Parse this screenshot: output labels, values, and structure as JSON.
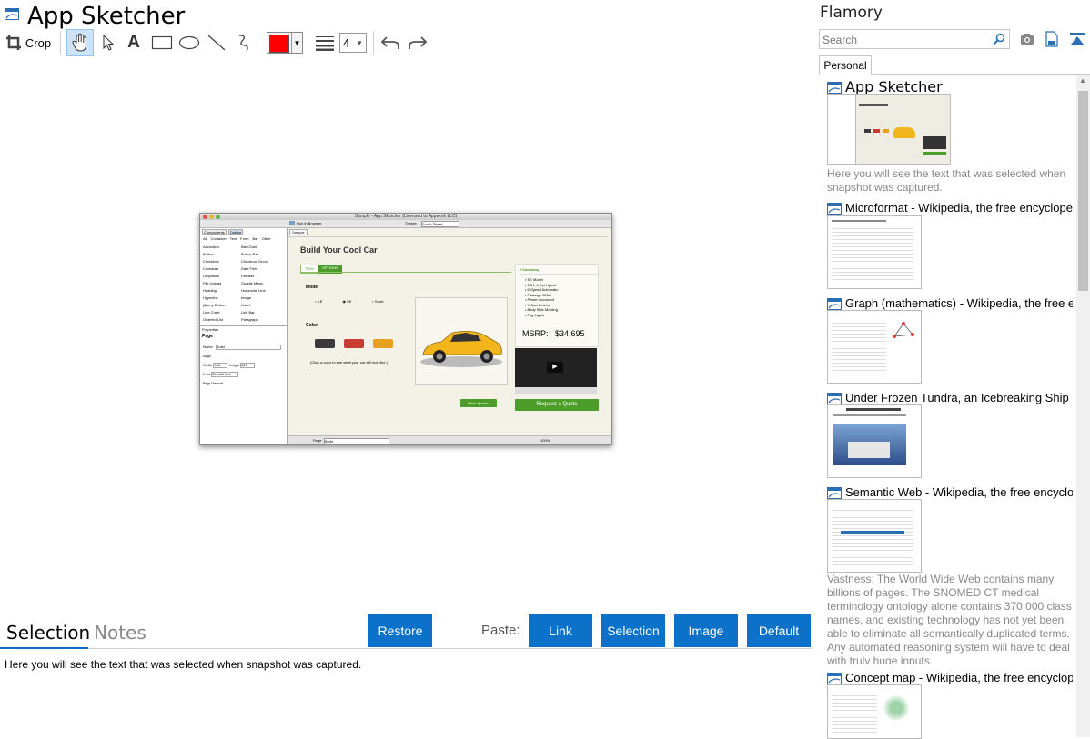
{
  "app": {
    "title": "App Sketcher"
  },
  "toolbar": {
    "crop_label": "Crop",
    "line_width": "4",
    "color": "#ff0000",
    "tools": [
      "hand-tool",
      "select-tool",
      "text-tool",
      "rectangle-tool",
      "ellipse-tool",
      "line-tool",
      "freehand-tool"
    ]
  },
  "bottom": {
    "tabs": [
      "Selection",
      "Notes"
    ],
    "restore_label": "Restore",
    "paste_label": "Paste:",
    "paste_buttons": [
      "Link",
      "Selection",
      "Image",
      "Default"
    ],
    "selection_text": "Here you will see the text that was selected when snapshot was captured."
  },
  "panel": {
    "title": "Flamory",
    "search_placeholder": "Search",
    "tab": "Personal",
    "entries": [
      {
        "title": "App Sketcher",
        "desc": "Here you will see the text that was selected when snapshot was captured."
      },
      {
        "title": "Microformat - Wikipedia, the free encyclopedia",
        "desc": ""
      },
      {
        "title": "Graph (mathematics) - Wikipedia, the free ency",
        "desc": ""
      },
      {
        "title": "Under Frozen Tundra, an Icebreaking Ship Unco",
        "desc": ""
      },
      {
        "title": "Semantic Web - Wikipedia, the free encycloped",
        "desc": "Vastness: The World Wide Web contains many billions of pages. The SNOMED CT medical terminology ontology alone contains 370,000 class names, and existing technology has not yet been able to eliminate all semantically duplicated terms. Any automated reasoning system will have to deal with truly huge inputs."
      },
      {
        "title": "Concept map - Wikipedia, the free encyclopedia",
        "desc": ""
      }
    ]
  },
  "snapshot": {
    "window_title": "Sample - App Sketcher (Licensed to Appwork LLC)",
    "run_label": "Run in Browser",
    "theme_label": "Theme:",
    "theme_value": "South Street",
    "sidebar_tabs": [
      "Components",
      "Outline"
    ],
    "filters": [
      "All",
      "Container",
      "Text",
      "Form",
      "Bar",
      "Other"
    ],
    "components_left": [
      "Accordion",
      "Button",
      "Checkbox",
      "Container",
      "Dropdown",
      "File Upload",
      "Heading",
      "Hyperlink",
      "jQuery Button",
      "Line Chart",
      "Ordered List"
    ],
    "components_right": [
      "Bar Chart",
      "Button Bar",
      "Checkbox Group",
      "Date Field",
      "Fieldset",
      "Google Maps",
      "Horizontal Line",
      "Image",
      "Label",
      "Link Bar",
      "Paragraph"
    ],
    "properties_tab": "Properties",
    "props_title": "Page",
    "prop_name_label": "Name",
    "prop_name_value": "Build",
    "prop_align_label": "Align",
    "prop_width_label": "Width",
    "prop_width_value": "960",
    "prop_height_label": "Height",
    "prop_height_value": "620",
    "prop_font_label": "Font",
    "prop_font_value": "Default font",
    "prop_bkgr_label": "Bkgr",
    "prop_bkgr_value": "Default",
    "doc_tab": "Sample",
    "heading": "Build Your Cool Car",
    "tabs": [
      "TRIM",
      "OPTIONS"
    ],
    "model_label": "Model",
    "models": [
      "LE",
      "SE",
      "Sport"
    ],
    "color_label": "Color",
    "color_hint": "(Click a color to see what your car will look like.)",
    "swatches": [
      "#3a3a3a",
      "#c83c32",
      "#e8a020"
    ],
    "summary_title": "Summary",
    "summary_items": [
      "SE Model",
      "2.5 L 4-Cyl Hybrid",
      "6-Speed Automatic",
      "Package 300A",
      "Power moonroof",
      "Yellow Exterior",
      "Body Side Molding",
      "Fog Lights"
    ],
    "msrp_label": "MSRP:",
    "msrp_value": "$34,695",
    "next_label": "Next: Options",
    "quote_label": "Request a Quote",
    "page_label": "Page:",
    "page_value": "Build",
    "zoom_value": "100%"
  }
}
